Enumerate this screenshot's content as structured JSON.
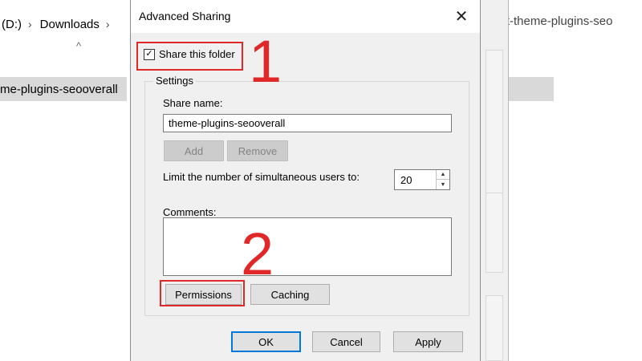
{
  "explorer": {
    "drive_label": "(D:)",
    "sep1": "›",
    "folder": "Downloads",
    "sep2": "›",
    "sort_arrow": "^",
    "selected_row": "me-plugins-seooverall",
    "right_title": "vienit-theme-plugins-seo"
  },
  "dialog": {
    "title": "Advanced Sharing",
    "close_glyph": "✕",
    "share_checkbox": {
      "label": "Share this folder",
      "checked": true,
      "glyph": "✓"
    },
    "settings": {
      "group_label": "Settings",
      "share_name_label": "Share name:",
      "share_name_value": "theme-plugins-seooverall",
      "add_label": "Add",
      "remove_label": "Remove",
      "limit_label": "Limit the number of simultaneous users to:",
      "limit_value": "20",
      "spin_up": "▲",
      "spin_down": "▼",
      "comments_label": "Comments:",
      "comments_value": "",
      "permissions_label": "Permissions",
      "caching_label": "Caching"
    },
    "buttons": {
      "ok": "OK",
      "cancel": "Cancel",
      "apply": "Apply"
    }
  },
  "annotations": {
    "step1": "1",
    "step2": "2",
    "color": "#e02828"
  },
  "colors": {
    "accent": "#0078d7",
    "dialog_bg": "#f0f0f0"
  }
}
